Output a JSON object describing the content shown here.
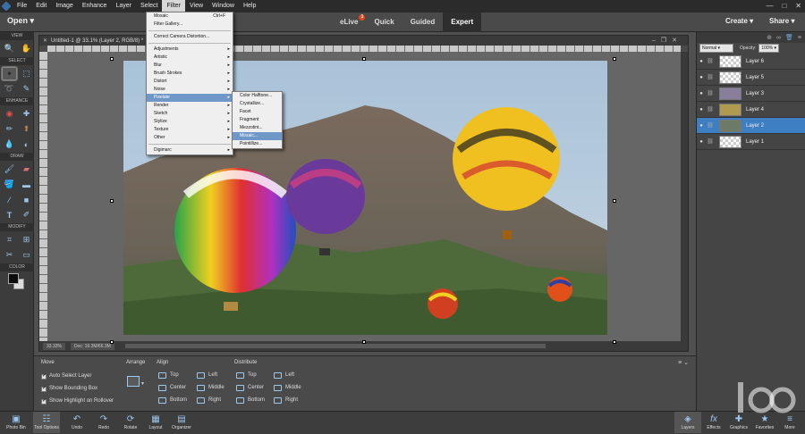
{
  "menubar": {
    "items": [
      "File",
      "Edit",
      "Image",
      "Enhance",
      "Layer",
      "Select",
      "Filter",
      "View",
      "Window",
      "Help"
    ],
    "active_index": 6
  },
  "modebar": {
    "open": "Open",
    "modes": [
      "eLive",
      "Quick",
      "Guided",
      "Expert"
    ],
    "active_mode": "Expert",
    "elive_badge": "1",
    "create": "Create",
    "share": "Share"
  },
  "toolbox": {
    "sections": [
      "VIEW",
      "SELECT",
      "ENHANCE",
      "DRAW",
      "MODIFY",
      "COLOR"
    ]
  },
  "document": {
    "tab_title": "Untitled-1 @ 33.1% (Layer 2, RGB/8) *",
    "zoom": "33.33%",
    "doc_size": "Doc: 19.3M/66.3M"
  },
  "layers_panel": {
    "blend_mode": "Normal",
    "opacity_label": "Opacity:",
    "opacity_value": "100%",
    "layers": [
      {
        "name": "Layer 6",
        "active": false
      },
      {
        "name": "Layer 5",
        "active": false
      },
      {
        "name": "Layer 3",
        "active": false
      },
      {
        "name": "Layer 4",
        "active": false
      },
      {
        "name": "Layer 2",
        "active": true
      },
      {
        "name": "Layer 1",
        "active": false
      }
    ]
  },
  "filter_menu": {
    "top_item": "Mosaic",
    "top_shortcut": "Ctrl+F",
    "gallery": "Filter Gallery...",
    "correct": "Correct Camera Distortion...",
    "submenus": [
      "Adjustments",
      "Artistic",
      "Blur",
      "Brush Strokes",
      "Distort",
      "Noise",
      "Pixelate",
      "Render",
      "Sketch",
      "Stylize",
      "Texture",
      "Other"
    ],
    "highlighted": "Pixelate",
    "digimarc": "Digimarc"
  },
  "pixelate_menu": {
    "items": [
      "Color Halftone...",
      "Crystallize...",
      "Facet",
      "Fragment",
      "Mezzotint...",
      "Mosaic...",
      "Pointillize..."
    ],
    "highlighted": "Mosaic..."
  },
  "tool_options": {
    "move_title": "Move",
    "auto_select": "Auto Select Layer",
    "show_bbox": "Show Bounding Box",
    "show_highlight": "Show Highlight on Rollover",
    "arrange_title": "Arrange",
    "align_title": "Align",
    "align_labels": [
      "Top",
      "Left",
      "Center",
      "Middle",
      "Bottom",
      "Right"
    ],
    "distribute_title": "Distribute",
    "distribute_labels": [
      "Top",
      "Left",
      "Center",
      "Middle",
      "Bottom",
      "Right"
    ]
  },
  "taskbar": {
    "left": [
      "Photo Bin",
      "Tool Options",
      "Undo",
      "Redo",
      "Rotate",
      "Layout",
      "Organizer"
    ],
    "right": [
      "Layers",
      "Effects",
      "Graphics",
      "Favorites",
      "More"
    ]
  },
  "colors": {
    "accent": "#3e7fc3",
    "menu_highlight": "#6f98c8",
    "badge": "#e04a1c"
  }
}
